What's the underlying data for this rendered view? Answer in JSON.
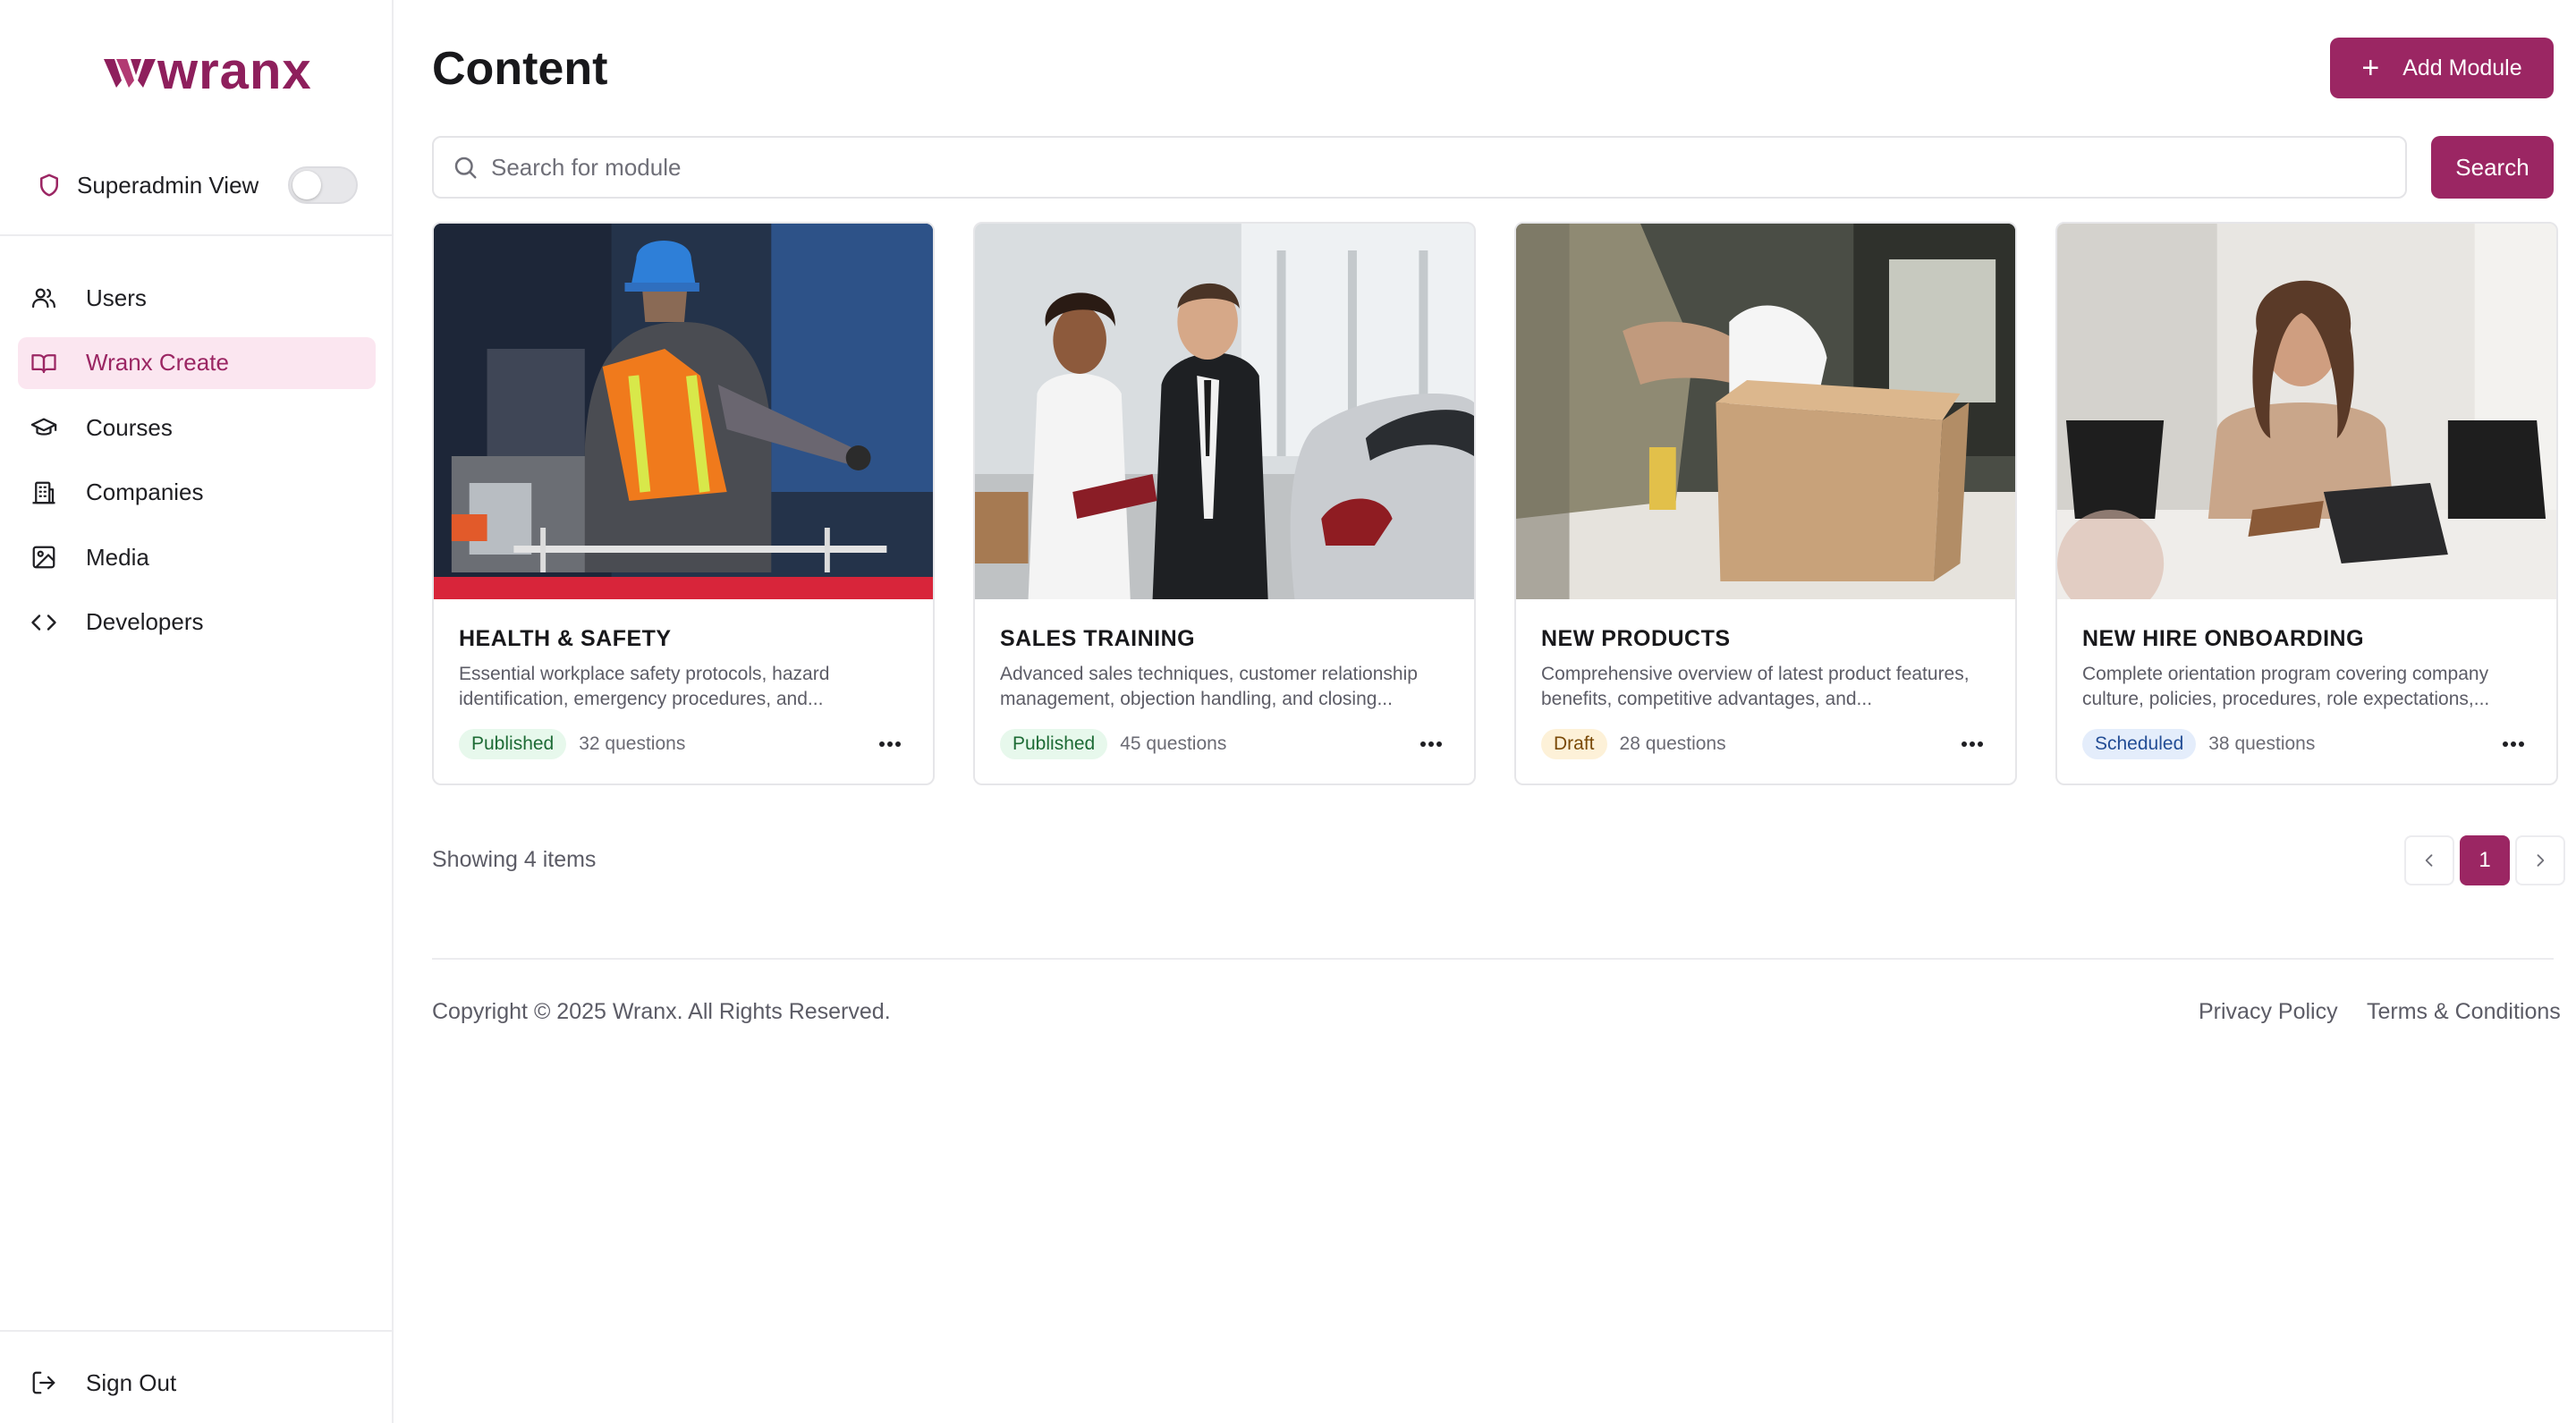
{
  "brand": {
    "name": "wranx",
    "accent": "#9b2663",
    "logo_color": "#8e1f5c"
  },
  "sidebar": {
    "superadmin_label": "Superadmin View",
    "superadmin_enabled": false,
    "items": [
      {
        "label": "Users",
        "icon": "users-icon",
        "active": false
      },
      {
        "label": "Wranx Create",
        "icon": "book-open-icon",
        "active": true
      },
      {
        "label": "Courses",
        "icon": "graduation-cap-icon",
        "active": false
      },
      {
        "label": "Companies",
        "icon": "building-icon",
        "active": false
      },
      {
        "label": "Media",
        "icon": "image-icon",
        "active": false
      },
      {
        "label": "Developers",
        "icon": "code-icon",
        "active": false
      }
    ],
    "signout_label": "Sign Out"
  },
  "header": {
    "title": "Content",
    "add_button_label": "Add Module"
  },
  "search": {
    "placeholder": "Search for module",
    "value": "",
    "button_label": "Search"
  },
  "modules": [
    {
      "title": "HEALTH & SAFETY",
      "description": "Essential workplace safety protocols, hazard identification, emergency procedures, and...",
      "status": "Published",
      "status_kind": "published",
      "questions": "32 questions"
    },
    {
      "title": "SALES TRAINING",
      "description": "Advanced sales techniques, customer relationship management, objection handling, and closing...",
      "status": "Published",
      "status_kind": "published",
      "questions": "45 questions"
    },
    {
      "title": "NEW PRODUCTS",
      "description": "Comprehensive overview of latest product features, benefits, competitive advantages, and...",
      "status": "Draft",
      "status_kind": "draft",
      "questions": "28 questions"
    },
    {
      "title": "NEW HIRE ONBOARDING",
      "description": "Complete orientation program covering company culture, policies, procedures, role expectations,...",
      "status": "Scheduled",
      "status_kind": "scheduled",
      "questions": "38 questions"
    }
  ],
  "pagination": {
    "showing_text": "Showing 4 items",
    "current_page": "1"
  },
  "footer": {
    "copyright": "Copyright © 2025 Wranx. All Rights Reserved.",
    "links": [
      "Privacy Policy",
      "Terms & Conditions"
    ]
  }
}
